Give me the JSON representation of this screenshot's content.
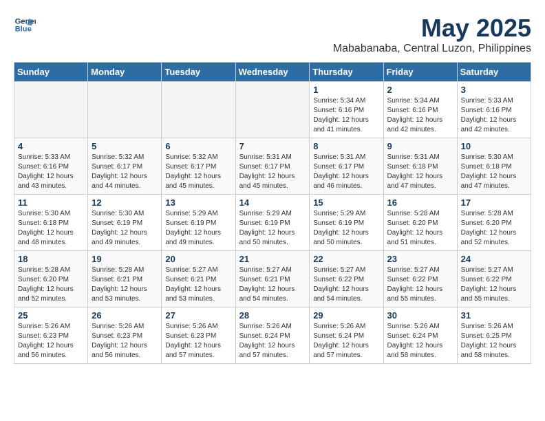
{
  "logo": {
    "line1": "General",
    "line2": "Blue"
  },
  "title": "May 2025",
  "subtitle": "Mababanaba, Central Luzon, Philippines",
  "days_header": [
    "Sunday",
    "Monday",
    "Tuesday",
    "Wednesday",
    "Thursday",
    "Friday",
    "Saturday"
  ],
  "weeks": [
    [
      {
        "day": "",
        "info": ""
      },
      {
        "day": "",
        "info": ""
      },
      {
        "day": "",
        "info": ""
      },
      {
        "day": "",
        "info": ""
      },
      {
        "day": "1",
        "info": "Sunrise: 5:34 AM\nSunset: 6:16 PM\nDaylight: 12 hours\nand 41 minutes."
      },
      {
        "day": "2",
        "info": "Sunrise: 5:34 AM\nSunset: 6:16 PM\nDaylight: 12 hours\nand 42 minutes."
      },
      {
        "day": "3",
        "info": "Sunrise: 5:33 AM\nSunset: 6:16 PM\nDaylight: 12 hours\nand 42 minutes."
      }
    ],
    [
      {
        "day": "4",
        "info": "Sunrise: 5:33 AM\nSunset: 6:16 PM\nDaylight: 12 hours\nand 43 minutes."
      },
      {
        "day": "5",
        "info": "Sunrise: 5:32 AM\nSunset: 6:17 PM\nDaylight: 12 hours\nand 44 minutes."
      },
      {
        "day": "6",
        "info": "Sunrise: 5:32 AM\nSunset: 6:17 PM\nDaylight: 12 hours\nand 45 minutes."
      },
      {
        "day": "7",
        "info": "Sunrise: 5:31 AM\nSunset: 6:17 PM\nDaylight: 12 hours\nand 45 minutes."
      },
      {
        "day": "8",
        "info": "Sunrise: 5:31 AM\nSunset: 6:17 PM\nDaylight: 12 hours\nand 46 minutes."
      },
      {
        "day": "9",
        "info": "Sunrise: 5:31 AM\nSunset: 6:18 PM\nDaylight: 12 hours\nand 47 minutes."
      },
      {
        "day": "10",
        "info": "Sunrise: 5:30 AM\nSunset: 6:18 PM\nDaylight: 12 hours\nand 47 minutes."
      }
    ],
    [
      {
        "day": "11",
        "info": "Sunrise: 5:30 AM\nSunset: 6:18 PM\nDaylight: 12 hours\nand 48 minutes."
      },
      {
        "day": "12",
        "info": "Sunrise: 5:30 AM\nSunset: 6:19 PM\nDaylight: 12 hours\nand 49 minutes."
      },
      {
        "day": "13",
        "info": "Sunrise: 5:29 AM\nSunset: 6:19 PM\nDaylight: 12 hours\nand 49 minutes."
      },
      {
        "day": "14",
        "info": "Sunrise: 5:29 AM\nSunset: 6:19 PM\nDaylight: 12 hours\nand 50 minutes."
      },
      {
        "day": "15",
        "info": "Sunrise: 5:29 AM\nSunset: 6:19 PM\nDaylight: 12 hours\nand 50 minutes."
      },
      {
        "day": "16",
        "info": "Sunrise: 5:28 AM\nSunset: 6:20 PM\nDaylight: 12 hours\nand 51 minutes."
      },
      {
        "day": "17",
        "info": "Sunrise: 5:28 AM\nSunset: 6:20 PM\nDaylight: 12 hours\nand 52 minutes."
      }
    ],
    [
      {
        "day": "18",
        "info": "Sunrise: 5:28 AM\nSunset: 6:20 PM\nDaylight: 12 hours\nand 52 minutes."
      },
      {
        "day": "19",
        "info": "Sunrise: 5:28 AM\nSunset: 6:21 PM\nDaylight: 12 hours\nand 53 minutes."
      },
      {
        "day": "20",
        "info": "Sunrise: 5:27 AM\nSunset: 6:21 PM\nDaylight: 12 hours\nand 53 minutes."
      },
      {
        "day": "21",
        "info": "Sunrise: 5:27 AM\nSunset: 6:21 PM\nDaylight: 12 hours\nand 54 minutes."
      },
      {
        "day": "22",
        "info": "Sunrise: 5:27 AM\nSunset: 6:22 PM\nDaylight: 12 hours\nand 54 minutes."
      },
      {
        "day": "23",
        "info": "Sunrise: 5:27 AM\nSunset: 6:22 PM\nDaylight: 12 hours\nand 55 minutes."
      },
      {
        "day": "24",
        "info": "Sunrise: 5:27 AM\nSunset: 6:22 PM\nDaylight: 12 hours\nand 55 minutes."
      }
    ],
    [
      {
        "day": "25",
        "info": "Sunrise: 5:26 AM\nSunset: 6:23 PM\nDaylight: 12 hours\nand 56 minutes."
      },
      {
        "day": "26",
        "info": "Sunrise: 5:26 AM\nSunset: 6:23 PM\nDaylight: 12 hours\nand 56 minutes."
      },
      {
        "day": "27",
        "info": "Sunrise: 5:26 AM\nSunset: 6:23 PM\nDaylight: 12 hours\nand 57 minutes."
      },
      {
        "day": "28",
        "info": "Sunrise: 5:26 AM\nSunset: 6:24 PM\nDaylight: 12 hours\nand 57 minutes."
      },
      {
        "day": "29",
        "info": "Sunrise: 5:26 AM\nSunset: 6:24 PM\nDaylight: 12 hours\nand 57 minutes."
      },
      {
        "day": "30",
        "info": "Sunrise: 5:26 AM\nSunset: 6:24 PM\nDaylight: 12 hours\nand 58 minutes."
      },
      {
        "day": "31",
        "info": "Sunrise: 5:26 AM\nSunset: 6:25 PM\nDaylight: 12 hours\nand 58 minutes."
      }
    ]
  ]
}
